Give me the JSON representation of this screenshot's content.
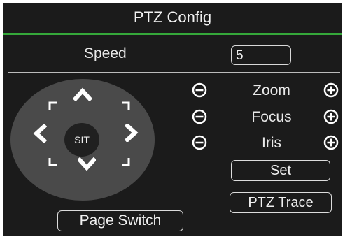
{
  "window": {
    "title": "PTZ Config"
  },
  "speed": {
    "label": "Speed",
    "value": "5"
  },
  "joystick": {
    "center_label": "SIT",
    "icons": [
      "arrow-up-icon",
      "arrow-down-icon",
      "arrow-left-icon",
      "arrow-right-icon",
      "arrow-up-left-icon",
      "arrow-up-right-icon",
      "arrow-down-left-icon",
      "arrow-down-right-icon"
    ]
  },
  "controls": [
    {
      "label": "Zoom"
    },
    {
      "label": "Focus"
    },
    {
      "label": "Iris"
    }
  ],
  "buttons": {
    "set": "Set",
    "ptz_trace": "PTZ Trace",
    "page_switch": "Page Switch"
  },
  "colors": {
    "background": "#1b1b1b",
    "accent_green": "#35a83a",
    "joystick": "#4a4a4a",
    "text": "#e8e8e8"
  }
}
